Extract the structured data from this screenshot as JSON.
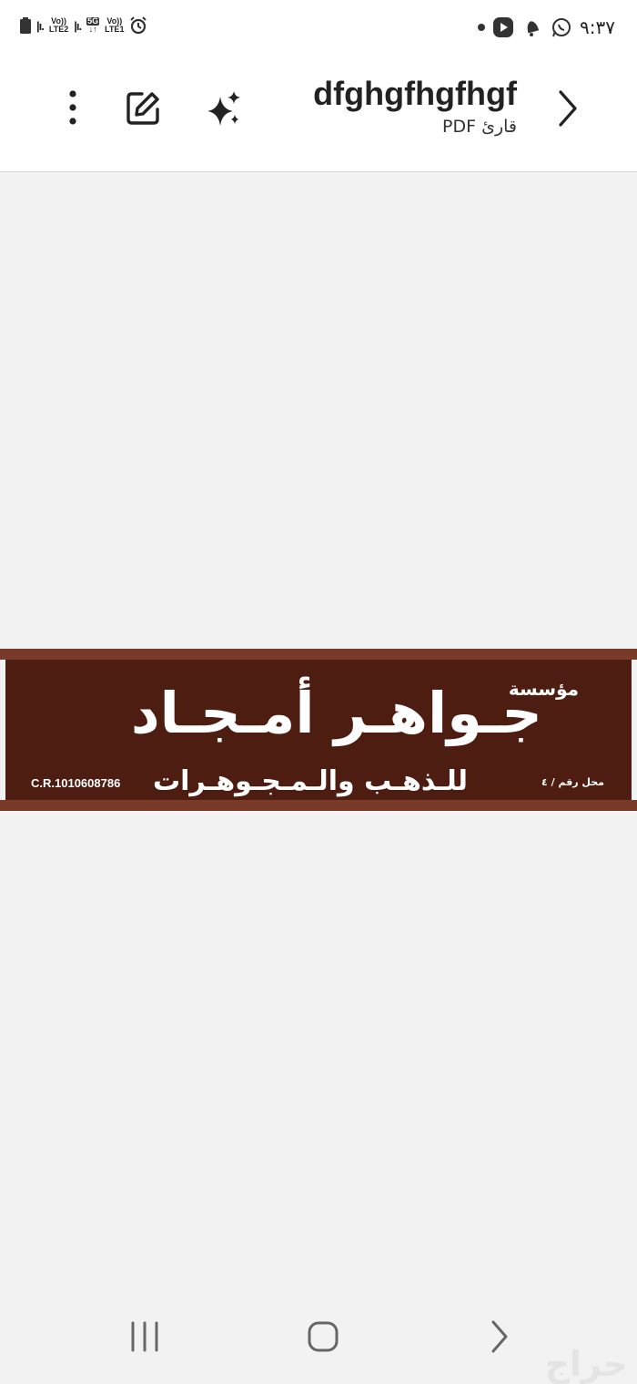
{
  "status_bar": {
    "time": "٩:٣٧",
    "left_labels": {
      "sim2_top": "Vo))",
      "sim2_bottom": "LTE2",
      "net_top": "5G",
      "sim1_top": "Vo))",
      "sim1_bottom": "LTE1"
    }
  },
  "app_bar": {
    "title": "dfghgfhgfhgf",
    "subtitle": "قارئ PDF"
  },
  "document": {
    "sign": {
      "establishment": "مؤسسة",
      "name": "جـواهـر أمـجـاد",
      "subtitle": "للـذهـب والـمـجـوهـرات",
      "shop_number": "محل رقم / ٤",
      "commercial_registration": "C.R.1010608786",
      "colors": {
        "panel": "#4e1d12",
        "frame": "#7a3a2a",
        "text": "#ffffff"
      }
    }
  },
  "watermark": "حراج"
}
